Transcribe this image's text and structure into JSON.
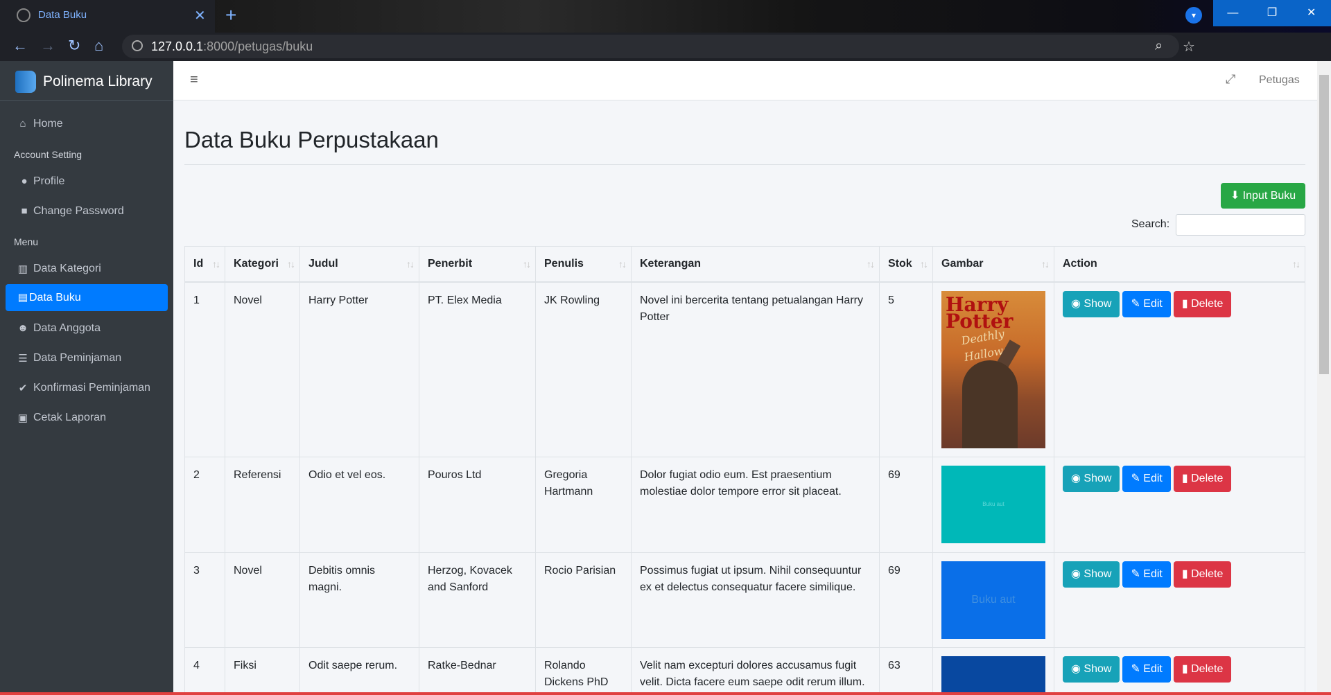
{
  "browser": {
    "tab_title": "Data Buku",
    "url_host": "127.0.0.1",
    "url_path": ":8000/petugas/buku"
  },
  "sidebar": {
    "brand": "Polinema Library",
    "home": "Home",
    "header_account": "Account Setting",
    "profile": "Profile",
    "change_password": "Change Password",
    "header_menu": "Menu",
    "items": [
      "Data Kategori",
      "Data Buku",
      "Data Anggota",
      "Data Peminjaman",
      "Konfirmasi Peminjaman",
      "Cetak Laporan"
    ]
  },
  "topnav": {
    "user": "Petugas"
  },
  "page": {
    "title": "Data Buku Perpustakaan",
    "input_button": "Input Buku",
    "search_label": "Search:"
  },
  "table": {
    "headers": [
      "Id",
      "Kategori",
      "Judul",
      "Penerbit",
      "Penulis",
      "Keterangan",
      "Stok",
      "Gambar",
      "Action"
    ],
    "rows": [
      {
        "id": "1",
        "kategori": "Novel",
        "judul": "Harry Potter",
        "penerbit": "PT. Elex Media",
        "penulis": "JK Rowling",
        "keterangan": "Novel ini bercerita tentang petualangan Harry Potter",
        "stok": "5"
      },
      {
        "id": "2",
        "kategori": "Referensi",
        "judul": "Odio et vel eos.",
        "penerbit": "Pouros Ltd",
        "penulis": "Gregoria Hartmann",
        "keterangan": "Dolor fugiat odio eum. Est praesentium molestiae dolor tempore error sit placeat.",
        "stok": "69",
        "img_text": "Buku aut"
      },
      {
        "id": "3",
        "kategori": "Novel",
        "judul": "Debitis omnis magni.",
        "penerbit": "Herzog, Kovacek and Sanford",
        "penulis": "Rocio Parisian",
        "keterangan": "Possimus fugiat ut ipsum. Nihil consequuntur ex et delectus consequatur facere similique.",
        "stok": "69",
        "img_text": "Buku aut"
      },
      {
        "id": "4",
        "kategori": "Fiksi",
        "judul": "Odit saepe rerum.",
        "penerbit": "Ratke-Bednar",
        "penulis": "Rolando Dickens PhD",
        "keterangan": "Velit nam excepturi dolores accusamus fugit velit. Dicta facere eum saepe odit rerum illum.",
        "stok": "63"
      }
    ],
    "actions": {
      "show": "Show",
      "edit": "Edit",
      "delete": "Delete"
    }
  },
  "cover": {
    "title": "Harry Potter",
    "subtitle": "Deathly Hallows"
  },
  "colors": {
    "sidebar": "#343a40",
    "active": "#007bff",
    "success": "#28a745",
    "info": "#17a2b8",
    "danger": "#dc3545"
  }
}
